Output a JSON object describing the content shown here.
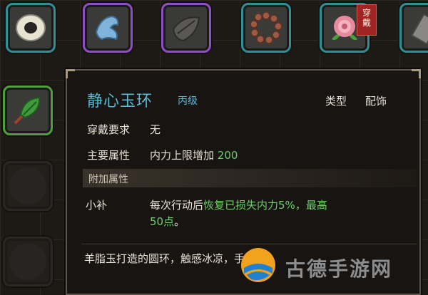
{
  "equipment_slots": [
    {
      "item": "jade-ring",
      "border": "#2f8f95"
    },
    {
      "item": "blue-ornament",
      "border": "#8e4fc4"
    },
    {
      "item": "dark-pouch",
      "border": "#8e4fc4"
    },
    {
      "item": "prayer-beads",
      "border": "#2f8f95"
    },
    {
      "item": "pink-flower",
      "border": "#2f8f95",
      "tag": "穿戴"
    },
    {
      "item": "gray-item",
      "border": "#2f8f95"
    }
  ],
  "left_slots": [
    {
      "item": "green-herb",
      "border": "#4ea13a"
    }
  ],
  "tooltip": {
    "title": "静心玉环",
    "grade": "丙级",
    "type_label": "类型",
    "type_value": "配饰",
    "requirement_label": "穿戴要求",
    "requirement_value": "无",
    "main_attr_label": "主要属性",
    "main_attr_text": "内力上限增加",
    "main_attr_value": "200",
    "bonus_section": "附加属性",
    "bonus_name": "小补",
    "bonus_prefix": "每次行动后",
    "bonus_effect": "恢复已损失内力5%，最高",
    "bonus_cap": "50点",
    "bonus_end": "。",
    "description": "羊脂玉打造的圆环，触感冰凉，手把斗",
    "colors": {
      "title": "#56b9d6",
      "value": "#6fcf6a"
    }
  },
  "watermark": "古德手游网"
}
